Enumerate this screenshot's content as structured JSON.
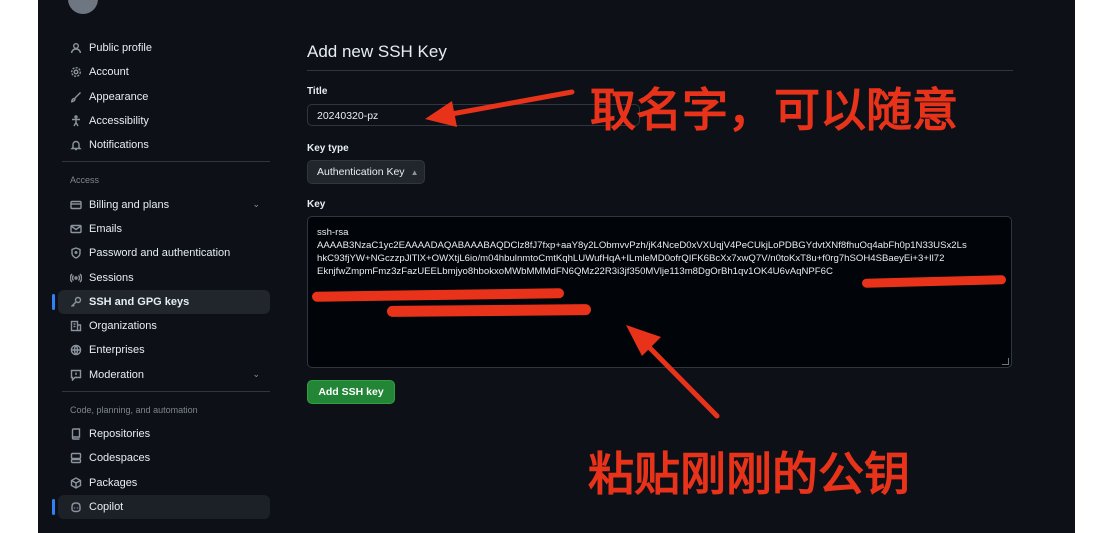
{
  "sidebar": {
    "items_top": [
      {
        "label": "Public profile",
        "icon": "person-icon"
      },
      {
        "label": "Account",
        "icon": "gear-icon"
      },
      {
        "label": "Appearance",
        "icon": "paintbrush-icon"
      },
      {
        "label": "Accessibility",
        "icon": "accessibility-icon"
      },
      {
        "label": "Notifications",
        "icon": "bell-icon"
      }
    ],
    "access_label": "Access",
    "items_access": [
      {
        "label": "Billing and plans",
        "icon": "credit-card-icon",
        "expandable": true
      },
      {
        "label": "Emails",
        "icon": "mail-icon"
      },
      {
        "label": "Password and authentication",
        "icon": "shield-lock-icon"
      },
      {
        "label": "Sessions",
        "icon": "broadcast-icon"
      },
      {
        "label": "SSH and GPG keys",
        "icon": "key-icon",
        "active": true
      },
      {
        "label": "Organizations",
        "icon": "organization-icon"
      },
      {
        "label": "Enterprises",
        "icon": "globe-icon"
      },
      {
        "label": "Moderation",
        "icon": "report-icon",
        "expandable": true
      }
    ],
    "code_label": "Code, planning, and automation",
    "items_code": [
      {
        "label": "Repositories",
        "icon": "repo-icon"
      },
      {
        "label": "Codespaces",
        "icon": "codespaces-icon"
      },
      {
        "label": "Packages",
        "icon": "package-icon"
      },
      {
        "label": "Copilot",
        "icon": "copilot-icon",
        "hovered": true
      }
    ]
  },
  "main": {
    "heading": "Add new SSH Key",
    "title_label": "Title",
    "title_value": "20240320-pz",
    "key_type_label": "Key type",
    "key_type_value": "Authentication Key",
    "key_label": "Key",
    "key_lines": [
      "ssh-rsa",
      "AAAAB3NzaC1yc2EAAAADAQABAAABAQDClz8fJ7fxp+aaY8y2LObmvvPzh/jK4NceD0xVXUqjV4PeCUkjLoPDBGYdvtXNf8fhuOq4abFh0p1N33USx2Ls",
      "hkC93fjYW+NGczzpJlTlX+OWXtjL6io/m04hbulnmtoCmtKqhLUWufHqA+ILmleMD0ofrQIFK6BcXx7xwQ7V/n0toKxT8u+f0rg7hSOH4SBaeyEi+3+Il72",
      "EknjfwZmpmFmz3zFazUEELbmjyo8hbokxoMWbMMMdFN6QMz22R3i3jf350MVlje113m8DgOrBh1qv1OK4U6vAqNPF6C"
    ],
    "add_button": "Add SSH key"
  },
  "annotations": {
    "top": "取名字，可以随意",
    "bottom": "粘贴刚刚的公钥",
    "color": "#e8331a"
  },
  "colors": {
    "background": "#0d1117",
    "accent": "#2f81f7",
    "primary_button": "#238636"
  }
}
